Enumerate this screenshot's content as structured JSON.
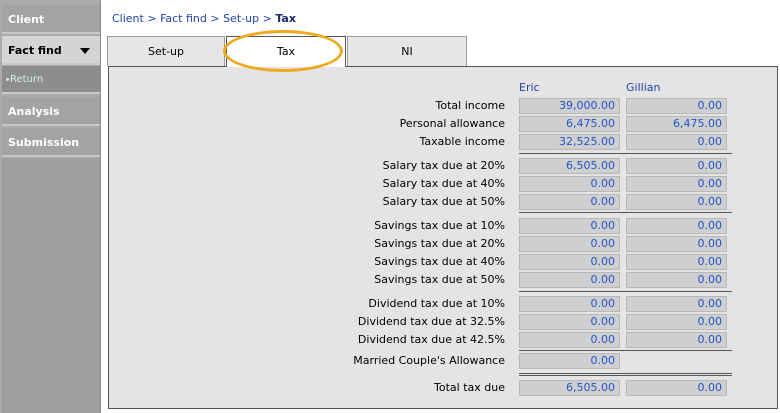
{
  "sidebar": {
    "items": [
      {
        "label": "Client"
      },
      {
        "label": "Fact find"
      },
      {
        "label": "Return"
      },
      {
        "label": "Analysis"
      },
      {
        "label": "Submission"
      }
    ]
  },
  "breadcrumb": {
    "items": [
      "Client",
      "Fact find",
      "Set-up"
    ],
    "separator": ">",
    "current": "Tax"
  },
  "tabs": [
    {
      "label": "Set-up"
    },
    {
      "label": "Tax"
    },
    {
      "label": "NI"
    }
  ],
  "columns": {
    "eric": "Eric",
    "gillian": "Gillian"
  },
  "rows": [
    {
      "label": "Total income",
      "eric": "39,000.00",
      "gillian": "0.00"
    },
    {
      "label": "Personal allowance",
      "eric": "6,475.00",
      "gillian": "6,475.00"
    },
    {
      "label": "Taxable income",
      "eric": "32,525.00",
      "gillian": "0.00"
    },
    {
      "label": "Salary tax due at 20%",
      "eric": "6,505.00",
      "gillian": "0.00"
    },
    {
      "label": "Salary tax due at 40%",
      "eric": "0.00",
      "gillian": "0.00"
    },
    {
      "label": "Salary tax due at 50%",
      "eric": "0.00",
      "gillian": "0.00"
    },
    {
      "label": "Savings tax due at 10%",
      "eric": "0.00",
      "gillian": "0.00"
    },
    {
      "label": "Savings tax due at 20%",
      "eric": "0.00",
      "gillian": "0.00"
    },
    {
      "label": "Savings tax due at 40%",
      "eric": "0.00",
      "gillian": "0.00"
    },
    {
      "label": "Savings tax due at 50%",
      "eric": "0.00",
      "gillian": "0.00"
    },
    {
      "label": "Dividend tax due at 10%",
      "eric": "0.00",
      "gillian": "0.00"
    },
    {
      "label": "Dividend tax due at 32.5%",
      "eric": "0.00",
      "gillian": "0.00"
    },
    {
      "label": "Dividend tax due at 42.5%",
      "eric": "0.00",
      "gillian": "0.00"
    },
    {
      "label": "Married Couple's Allowance",
      "eric": "0.00"
    },
    {
      "label": "Total tax due",
      "eric": "6,505.00",
      "gillian": "0.00"
    }
  ],
  "colors": {
    "accent_blue": "#2255cc",
    "highlight": "#f0a820"
  }
}
